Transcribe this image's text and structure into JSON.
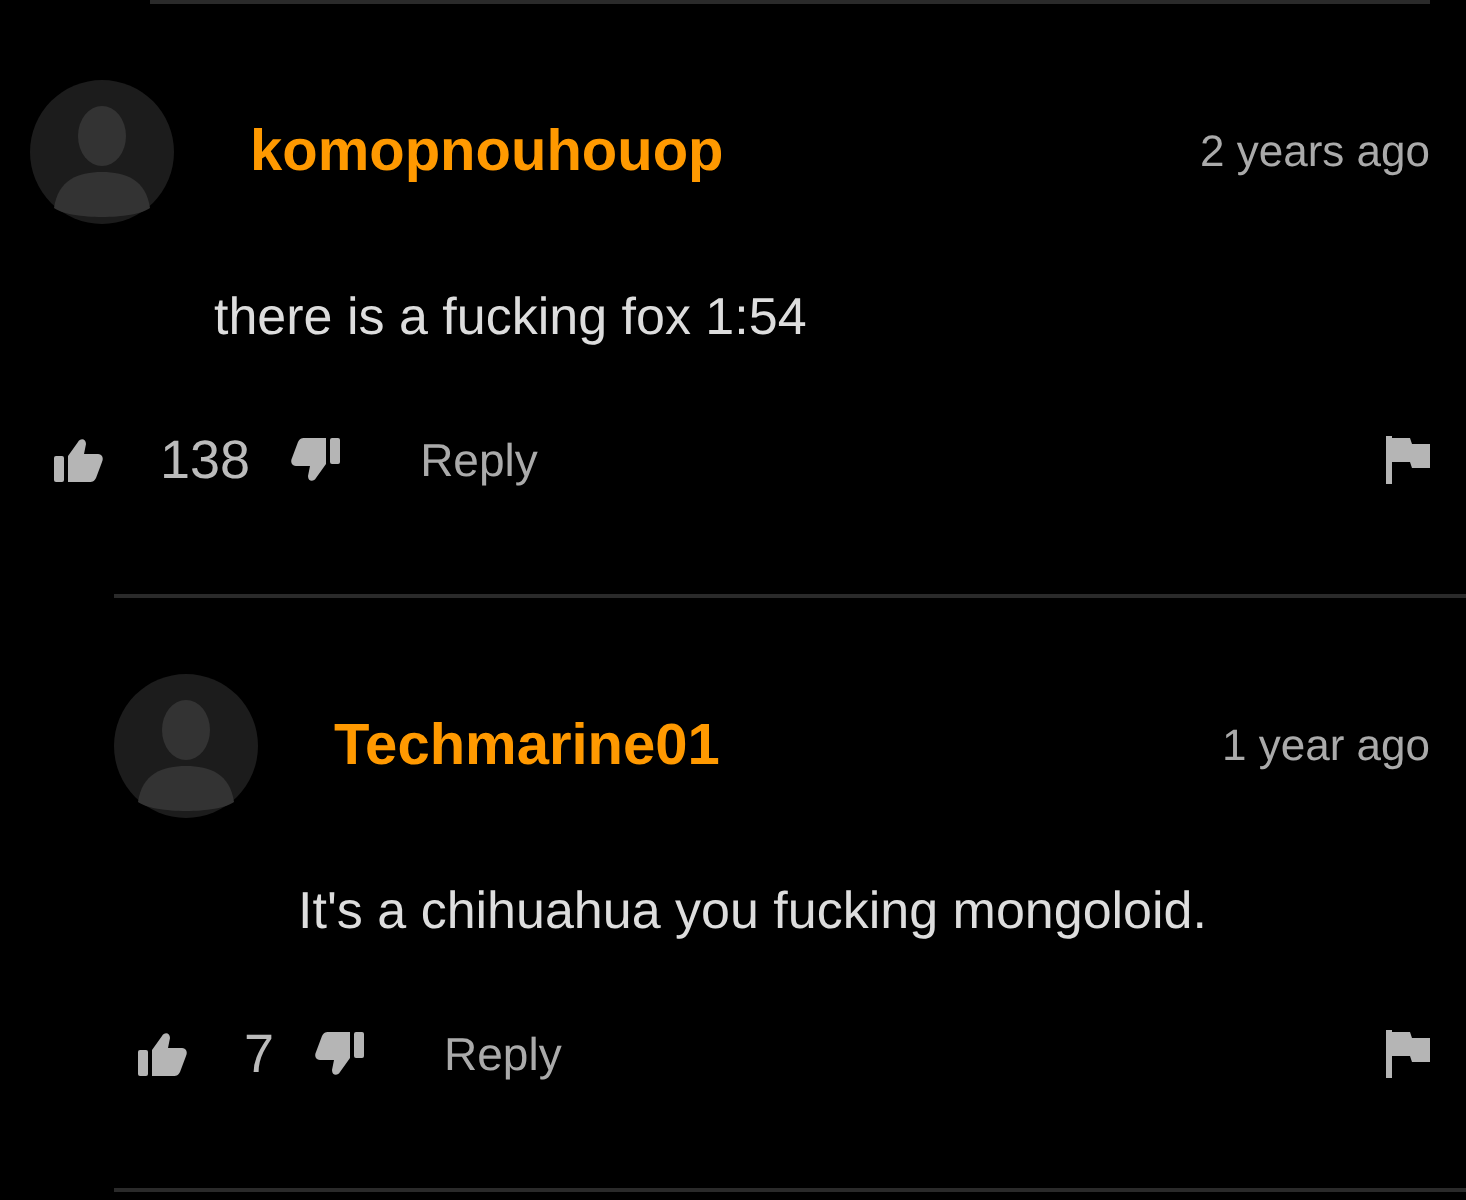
{
  "comments": [
    {
      "username": "komopnouhouop",
      "time": "2 years ago",
      "text": "there is a fucking fox 1:54",
      "likes": "138",
      "reply_label": "Reply",
      "children": [
        {
          "username": "Techmarine01",
          "time": "1 year ago",
          "text": "It's a chihuahua you fucking mongoloid.",
          "likes": "7",
          "reply_label": "Reply"
        }
      ]
    }
  ]
}
